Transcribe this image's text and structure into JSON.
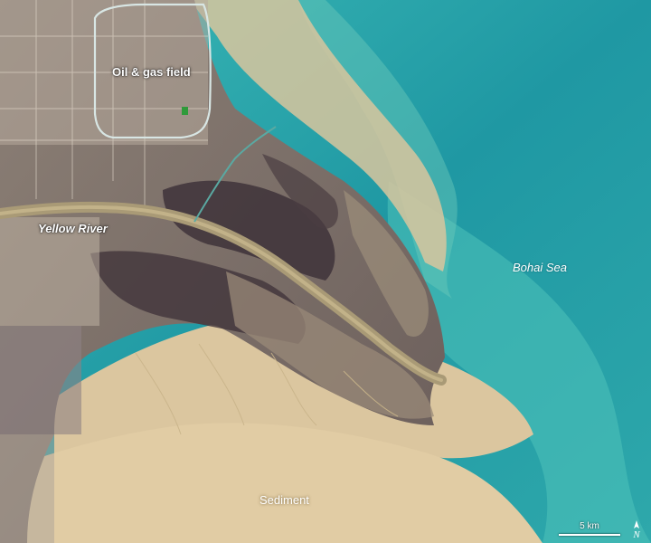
{
  "map": {
    "labels": {
      "oil_gas_field": "Oil & gas field",
      "yellow_river": "Yellow River",
      "bohai_sea": "Bohai Sea",
      "sediment": "Sediment"
    },
    "scale_bar": {
      "label": "5 km"
    },
    "north_arrow": {
      "symbol": "N"
    },
    "colors": {
      "sea_deep": "#1f98a3",
      "sea_light": "#4fc0b8",
      "sediment": "#d9c39a",
      "land_dark": "#4f4248",
      "land_light": "#b9a99a",
      "river": "#a89a78"
    }
  }
}
